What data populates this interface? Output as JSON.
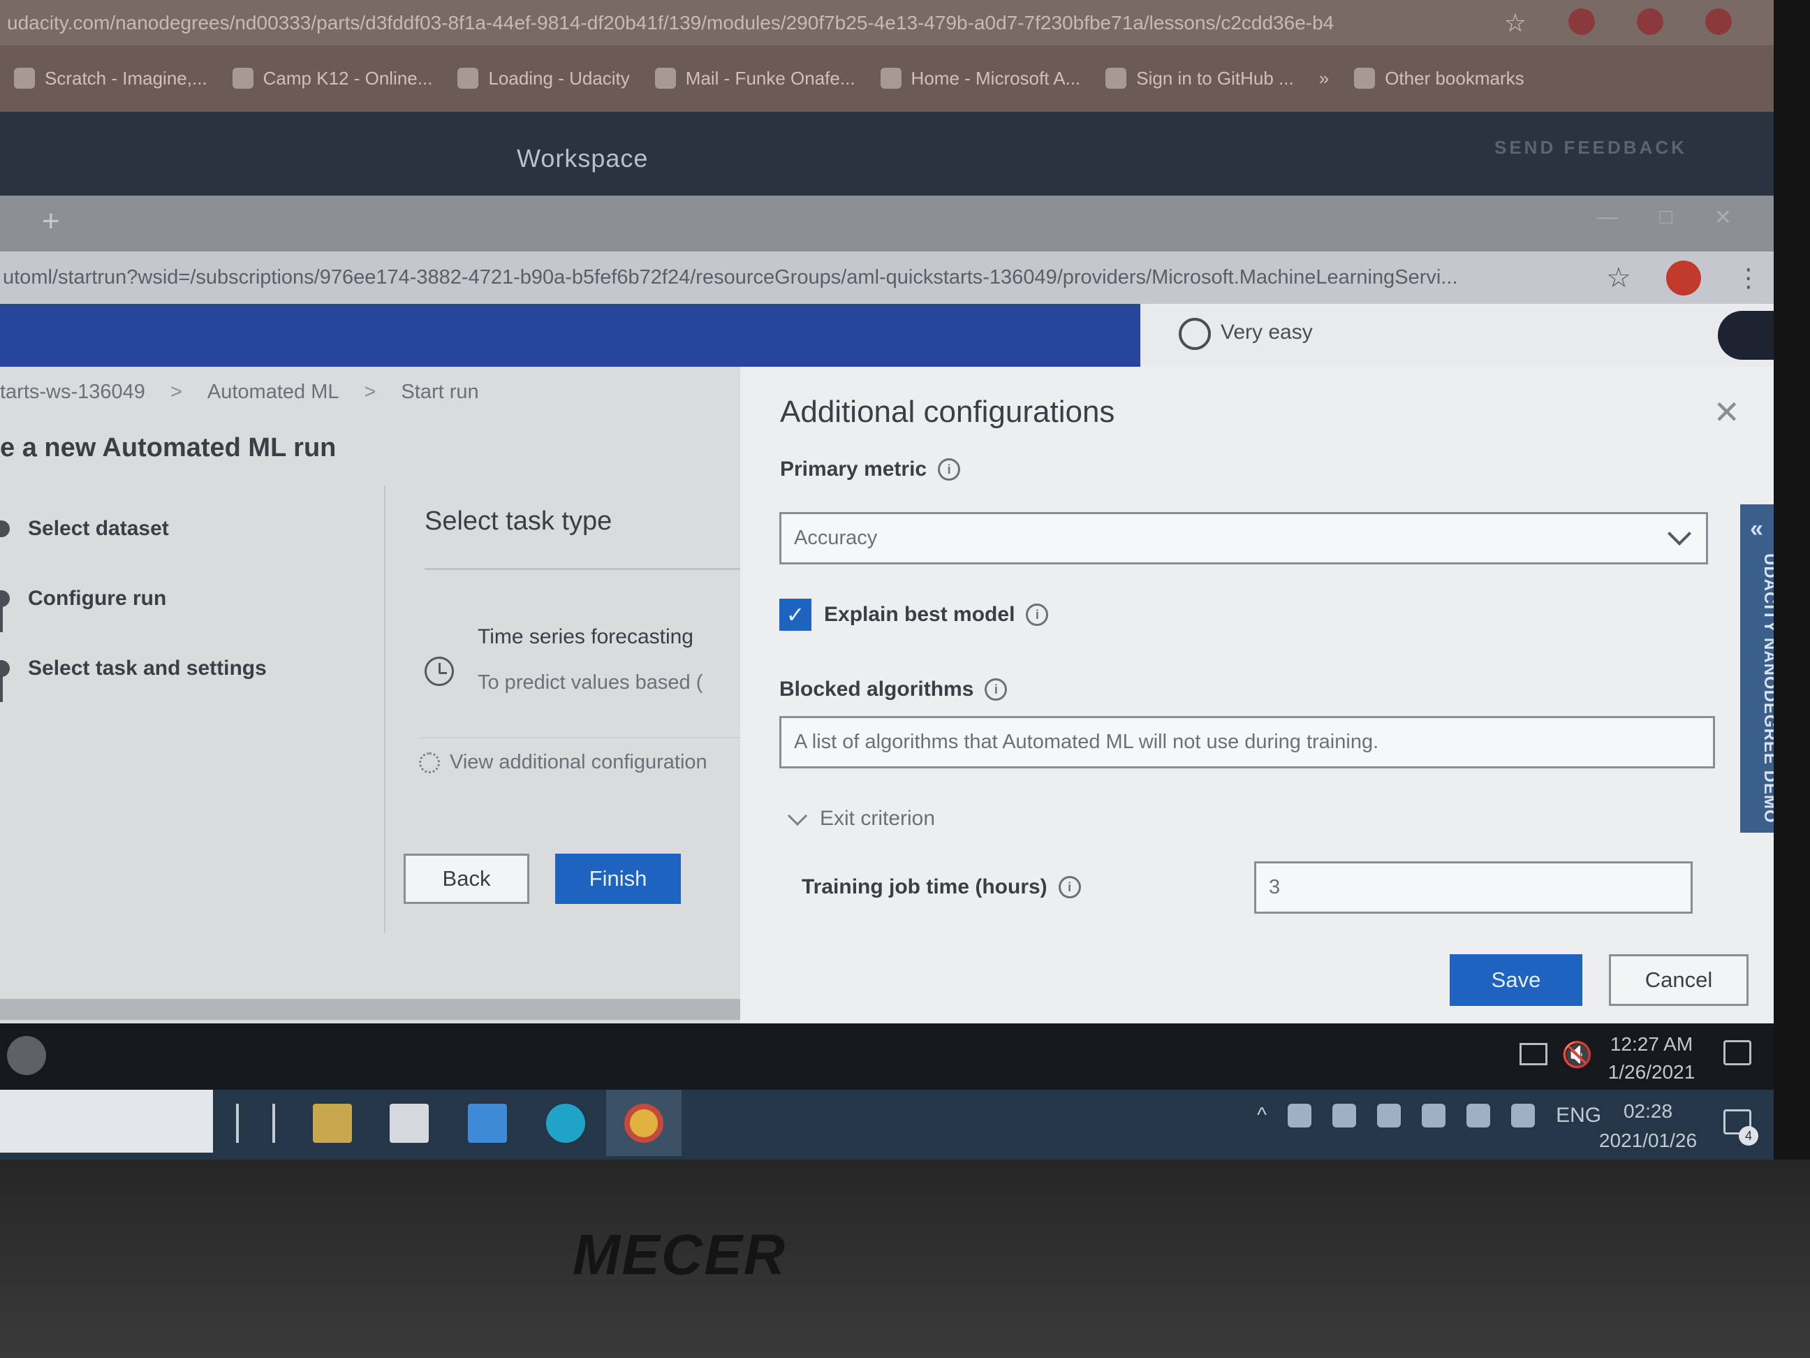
{
  "outer_browser": {
    "url": "udacity.com/nanodegrees/nd00333/parts/d3fddf03-8f1a-44ef-9814-df20b41f/139/modules/290f7b25-4e13-479b-a0d7-7f230bfbe71a/lessons/c2cdd36e-b4",
    "bookmarks": [
      "Scratch - Imagine,...",
      "Camp K12 - Online...",
      "Loading - Udacity",
      "Mail - Funke Onafe...",
      "Home - Microsoft A...",
      "Sign in to GitHub ..."
    ],
    "more_bookmarks": "»",
    "other_bookmarks": "Other bookmarks"
  },
  "workspace": {
    "title": "Workspace",
    "feedback": "SEND FEEDBACK"
  },
  "inner_browser": {
    "new_tab": "+",
    "url": "utoml/startrun?wsid=/subscriptions/976ee174-3882-4721-b90a-b5fef6b72f24/resourceGroups/aml-quickstarts-136049/providers/Microsoft.MachineLearningServi..."
  },
  "rating": {
    "option": "Very easy"
  },
  "breadcrumb": [
    "tarts-ws-136049",
    "Automated ML",
    "Start run"
  ],
  "page": {
    "title": "e a new Automated ML run"
  },
  "steps": [
    "Select dataset",
    "Configure run",
    "Select task and settings"
  ],
  "task_panel": {
    "heading": "Select task type",
    "option_title": "Time series forecasting",
    "option_desc": "To predict values based (",
    "view_config": "View additional configuration"
  },
  "buttons": {
    "back": "Back",
    "finish": "Finish",
    "save": "Save",
    "cancel": "Cancel"
  },
  "dialog": {
    "title": "Additional configurations",
    "close": "✕",
    "primary_metric_label": "Primary metric",
    "primary_metric_value": "Accuracy",
    "explain_best_model_label": "Explain best model",
    "explain_best_model_checked": true,
    "blocked_algorithms_label": "Blocked algorithms",
    "blocked_algorithms_placeholder": "A list of algorithms that Automated ML will not use during training.",
    "exit_criterion": "Exit criterion",
    "training_time_label": "Training job time (hours)",
    "training_time_value": "3"
  },
  "side_tab": {
    "label": "UDACITY NANODEGREE DEMO"
  },
  "inner_taskbar": {
    "time": "12:27 AM",
    "date": "1/26/2021"
  },
  "outer_taskbar": {
    "language": "ENG",
    "time": "02:28",
    "date": "2021/01/26",
    "notification_count": "4"
  },
  "laptop": {
    "brand": "MECER"
  },
  "colors": {
    "azure_header": "#25449a",
    "primary_button": "#1f63c1",
    "workspace_bar": "#2b3340",
    "side_tab": "#3a5f8a"
  }
}
